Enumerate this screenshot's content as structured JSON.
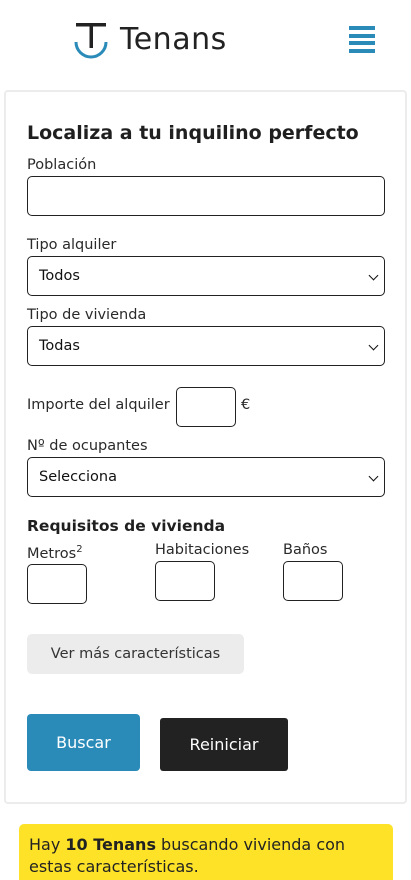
{
  "header": {
    "brand": "Tenans",
    "logo_letter": "T",
    "menu_icon": "hamburger-menu-icon",
    "accent_color": "#2a8ab8"
  },
  "form": {
    "title": "Localiza a tu inquilino perfecto",
    "poblacion_label": "Población",
    "poblacion_value": "",
    "tipo_alquiler_label": "Tipo alquiler",
    "tipo_alquiler_value": "Todos",
    "tipo_vivienda_label": "Tipo de vivienda",
    "tipo_vivienda_value": "Todas",
    "importe_label": "Importe del alquiler",
    "importe_value": "",
    "currency": "€",
    "ocupantes_label": "Nº de ocupantes",
    "ocupantes_value": "Selecciona",
    "requisitos_title": "Requisitos de vivienda",
    "metros_label": "Metros",
    "metros_sup": "2",
    "habitaciones_label": "Habitaciones",
    "banos_label": "Baños",
    "more_button": "Ver más características",
    "search_button": "Buscar",
    "reset_button": "Reiniciar",
    "search_color": "#2a8ab8",
    "reset_color": "#222222"
  },
  "notice": {
    "prefix": "Hay ",
    "count_text": "10 Tenans",
    "suffix": " buscando vivienda con estas características.",
    "background": "#fde228"
  }
}
